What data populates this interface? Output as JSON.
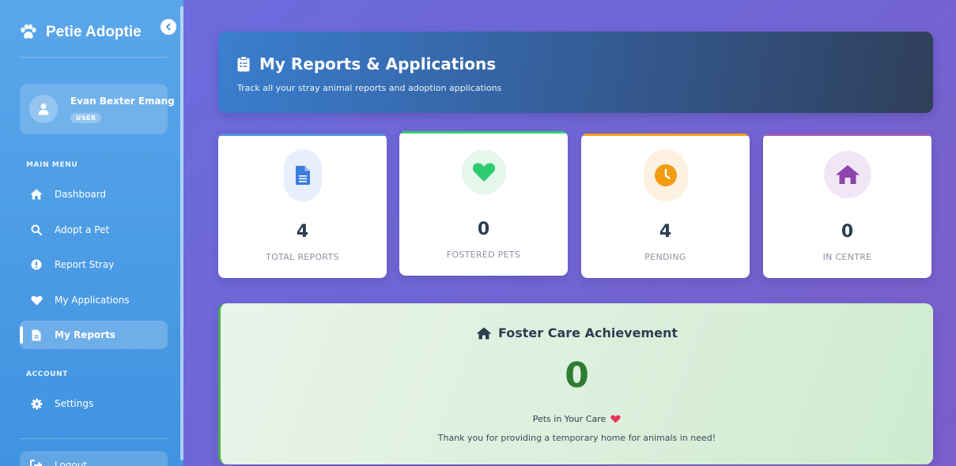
{
  "app": {
    "name": "Petie Adoptie"
  },
  "user": {
    "name": "Evan Bexter Emang",
    "role": "USER"
  },
  "sidebar": {
    "main_menu_label": "MAIN MENU",
    "items": [
      {
        "label": "Dashboard",
        "icon": "home-icon"
      },
      {
        "label": "Adopt a Pet",
        "icon": "search-icon"
      },
      {
        "label": "Report Stray",
        "icon": "alert-icon"
      },
      {
        "label": "My Applications",
        "icon": "heart-icon"
      },
      {
        "label": "My Reports",
        "icon": "document-icon",
        "active": true
      }
    ],
    "account_label": "ACCOUNT",
    "account_items": [
      {
        "label": "Settings",
        "icon": "gear-icon"
      }
    ],
    "logout_label": "Logout"
  },
  "header": {
    "title": "My Reports & Applications",
    "subtitle": "Track all your stray animal reports and adoption applications"
  },
  "stats": [
    {
      "value": "4",
      "label": "TOTAL REPORTS",
      "icon": "document-icon",
      "color": "#3b7ddd",
      "bg": "#e8eefb",
      "bar": "#4a90e2"
    },
    {
      "value": "0",
      "label": "FOSTERED PETS",
      "icon": "heart-icon",
      "color": "#2ecc71",
      "bg": "#e6f7ec",
      "bar": "#2ecc71"
    },
    {
      "value": "4",
      "label": "PENDING",
      "icon": "clock-icon",
      "color": "#f39c12",
      "bg": "#fdf1e1",
      "bar": "#f39c12"
    },
    {
      "value": "0",
      "label": "IN CENTRE",
      "icon": "house-icon",
      "color": "#8e44ad",
      "bg": "#f1e6f6",
      "bar": "#9b59b6"
    }
  ],
  "achievement": {
    "title": "Foster Care Achievement",
    "value": "0",
    "caption": "Pets in Your Care",
    "text": "Thank you for providing a temporary home for animals in need!"
  }
}
